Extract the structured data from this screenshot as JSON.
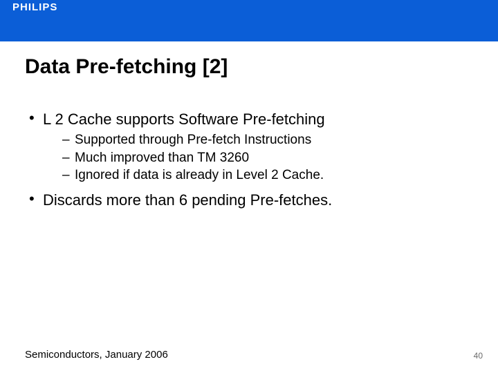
{
  "brand": "PHILIPS",
  "title": "Data Pre-fetching [2]",
  "bullets": {
    "b0": "L 2 Cache supports Software Pre-fetching",
    "b0_sub0": "Supported through Pre-fetch Instructions",
    "b0_sub1": "Much improved than TM 3260",
    "b0_sub2": "Ignored if data is already in Level 2 Cache.",
    "b1": "Discards more than 6 pending Pre-fetches."
  },
  "footer_left": "Semiconductors, January 2006",
  "footer_right": "40"
}
